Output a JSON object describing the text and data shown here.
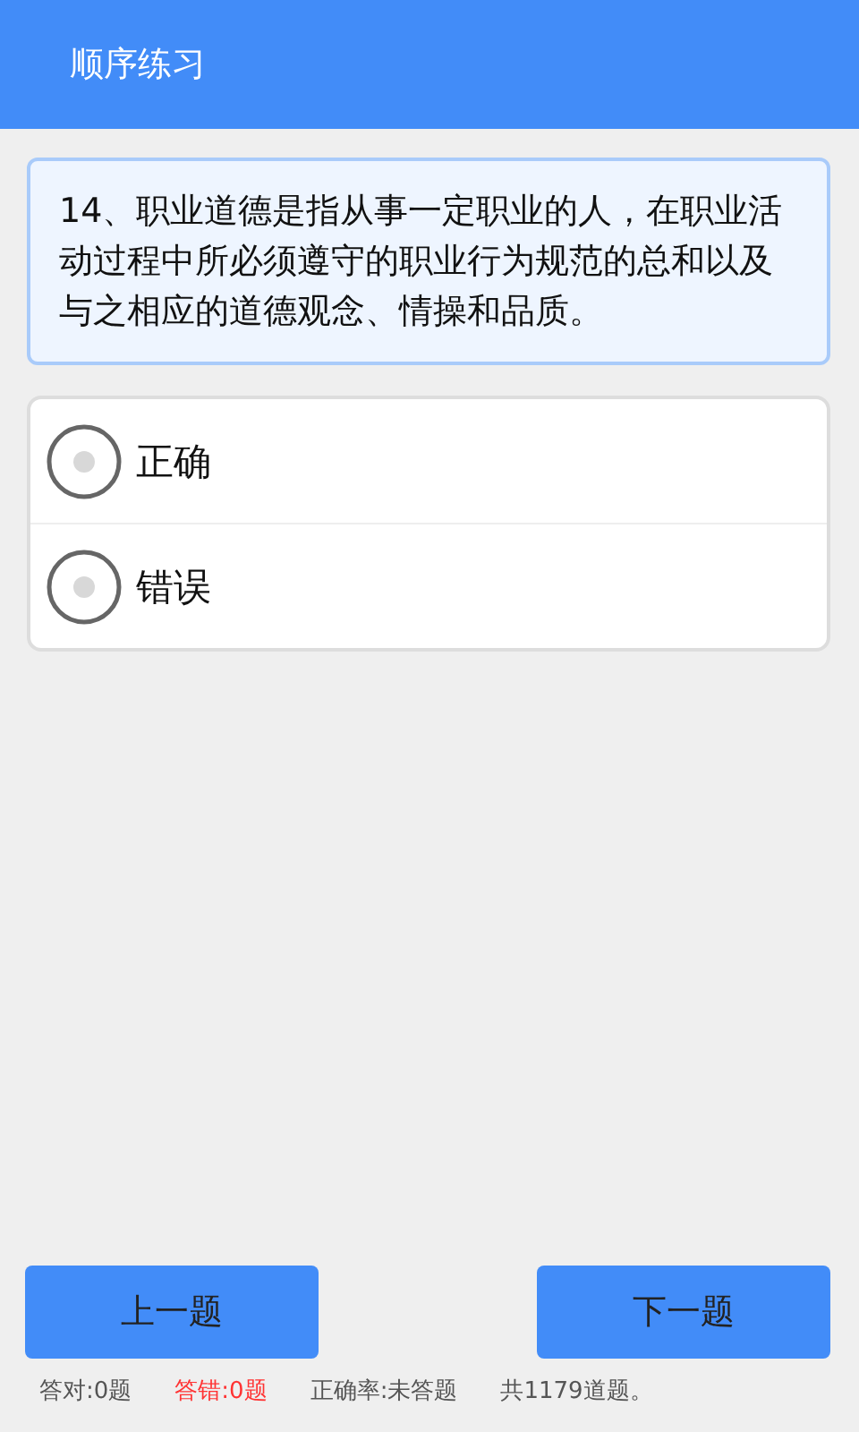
{
  "header": {
    "title": "顺序练习"
  },
  "question": {
    "text": "14、职业道德是指从事一定职业的人，在职业活动过程中所必须遵守的职业行为规范的总和以及与之相应的道德观念、情操和品质。"
  },
  "options": [
    {
      "label": "正确",
      "selected": false
    },
    {
      "label": "错误",
      "selected": false
    }
  ],
  "buttons": [
    "上一题",
    "下一题"
  ],
  "stats": [
    {
      "text": "答对:0题",
      "color": "#555555"
    },
    {
      "text": "答错:0题",
      "color": "#ff3333"
    },
    {
      "text": "正确率:未答题",
      "color": "#555555"
    },
    {
      "text": "共1179道题。",
      "color": "#555555"
    }
  ]
}
